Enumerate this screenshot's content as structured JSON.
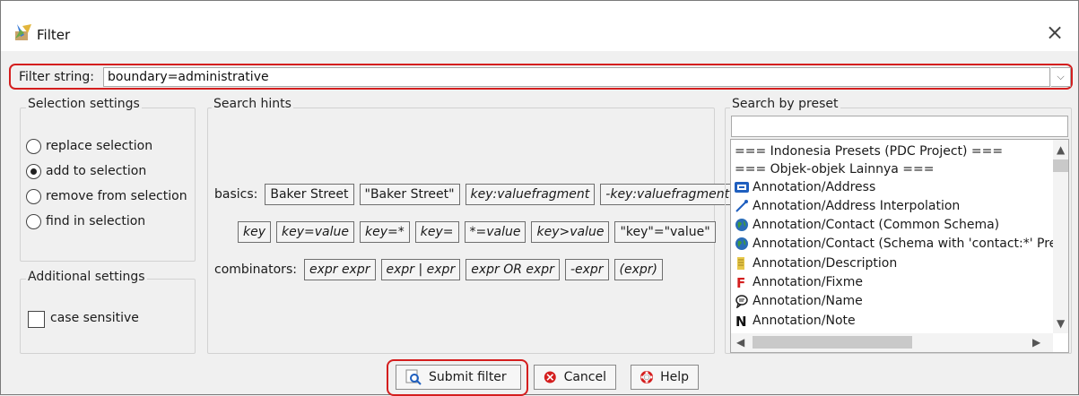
{
  "window": {
    "title": "Filter",
    "close_glyph": "×"
  },
  "filter": {
    "label": "Filter string:",
    "value": "boundary=administrative",
    "dropdown_glyph": "⌵"
  },
  "selection_settings": {
    "title": "Selection settings",
    "options": [
      {
        "label": "replace selection",
        "checked": false
      },
      {
        "label": "add to selection",
        "checked": true
      },
      {
        "label": "remove from selection",
        "checked": false
      },
      {
        "label": "find in selection",
        "checked": false
      }
    ]
  },
  "additional_settings": {
    "title": "Additional settings",
    "case_sensitive_label": "case sensitive",
    "case_sensitive_checked": false
  },
  "search_hints": {
    "title": "Search hints",
    "basics_label": "basics:",
    "combinators_label": "combinators:",
    "basics_row1": [
      "Baker Street",
      "\"Baker Street\"",
      "key:valuefragment",
      "-key:valuefragment"
    ],
    "basics_row2": [
      "key",
      "key=value",
      "key=*",
      "key=",
      "*=value",
      "key>value",
      "\"key\"=\"value\""
    ],
    "combinators": [
      "expr expr",
      "expr | expr",
      "expr OR expr",
      "-expr",
      "(expr)"
    ]
  },
  "presets": {
    "title": "Search by preset",
    "search_value": "",
    "items": [
      {
        "label": "=== Indonesia Presets (PDC Project) ===",
        "icon": "none"
      },
      {
        "label": "=== Objek-objek Lainnya ===",
        "icon": "none"
      },
      {
        "label": "Annotation/Address",
        "icon": "address-card-icon"
      },
      {
        "label": "Annotation/Address Interpolation",
        "icon": "interpolation-line-icon"
      },
      {
        "label": "Annotation/Contact (Common Schema)",
        "icon": "globe-icon"
      },
      {
        "label": "Annotation/Contact (Schema with 'contact:*' Pre",
        "icon": "globe-icon"
      },
      {
        "label": "Annotation/Description",
        "icon": "description-icon"
      },
      {
        "label": "Annotation/Fixme",
        "icon": "fixme-icon"
      },
      {
        "label": "Annotation/Name",
        "icon": "name-bubble-icon"
      },
      {
        "label": "Annotation/Note",
        "icon": "note-icon"
      }
    ]
  },
  "buttons": {
    "submit": "Submit filter",
    "cancel": "Cancel",
    "help": "Help"
  },
  "colors": {
    "highlight": "#d41e1e",
    "accent_blue": "#1f5fbf"
  }
}
